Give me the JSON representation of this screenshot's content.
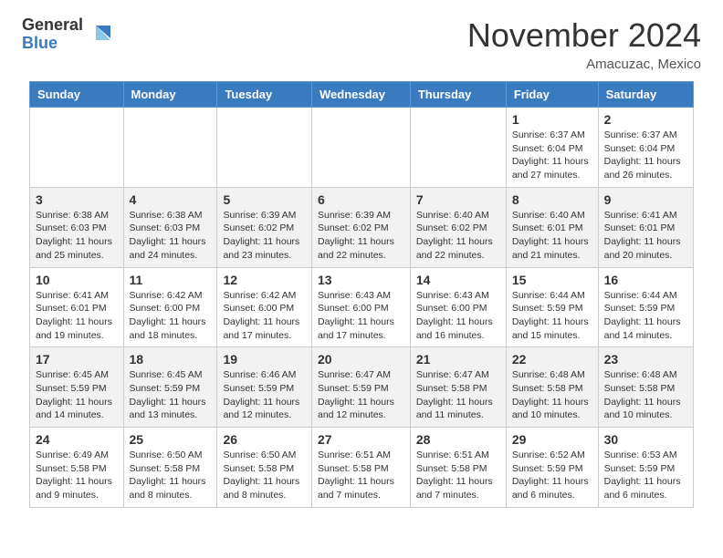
{
  "header": {
    "logo_general": "General",
    "logo_blue": "Blue",
    "month_title": "November 2024",
    "location": "Amacuzac, Mexico"
  },
  "days_of_week": [
    "Sunday",
    "Monday",
    "Tuesday",
    "Wednesday",
    "Thursday",
    "Friday",
    "Saturday"
  ],
  "weeks": [
    [
      {
        "day": "",
        "info": ""
      },
      {
        "day": "",
        "info": ""
      },
      {
        "day": "",
        "info": ""
      },
      {
        "day": "",
        "info": ""
      },
      {
        "day": "",
        "info": ""
      },
      {
        "day": "1",
        "info": "Sunrise: 6:37 AM\nSunset: 6:04 PM\nDaylight: 11 hours and 27 minutes."
      },
      {
        "day": "2",
        "info": "Sunrise: 6:37 AM\nSunset: 6:04 PM\nDaylight: 11 hours and 26 minutes."
      }
    ],
    [
      {
        "day": "3",
        "info": "Sunrise: 6:38 AM\nSunset: 6:03 PM\nDaylight: 11 hours and 25 minutes."
      },
      {
        "day": "4",
        "info": "Sunrise: 6:38 AM\nSunset: 6:03 PM\nDaylight: 11 hours and 24 minutes."
      },
      {
        "day": "5",
        "info": "Sunrise: 6:39 AM\nSunset: 6:02 PM\nDaylight: 11 hours and 23 minutes."
      },
      {
        "day": "6",
        "info": "Sunrise: 6:39 AM\nSunset: 6:02 PM\nDaylight: 11 hours and 22 minutes."
      },
      {
        "day": "7",
        "info": "Sunrise: 6:40 AM\nSunset: 6:02 PM\nDaylight: 11 hours and 22 minutes."
      },
      {
        "day": "8",
        "info": "Sunrise: 6:40 AM\nSunset: 6:01 PM\nDaylight: 11 hours and 21 minutes."
      },
      {
        "day": "9",
        "info": "Sunrise: 6:41 AM\nSunset: 6:01 PM\nDaylight: 11 hours and 20 minutes."
      }
    ],
    [
      {
        "day": "10",
        "info": "Sunrise: 6:41 AM\nSunset: 6:01 PM\nDaylight: 11 hours and 19 minutes."
      },
      {
        "day": "11",
        "info": "Sunrise: 6:42 AM\nSunset: 6:00 PM\nDaylight: 11 hours and 18 minutes."
      },
      {
        "day": "12",
        "info": "Sunrise: 6:42 AM\nSunset: 6:00 PM\nDaylight: 11 hours and 17 minutes."
      },
      {
        "day": "13",
        "info": "Sunrise: 6:43 AM\nSunset: 6:00 PM\nDaylight: 11 hours and 17 minutes."
      },
      {
        "day": "14",
        "info": "Sunrise: 6:43 AM\nSunset: 6:00 PM\nDaylight: 11 hours and 16 minutes."
      },
      {
        "day": "15",
        "info": "Sunrise: 6:44 AM\nSunset: 5:59 PM\nDaylight: 11 hours and 15 minutes."
      },
      {
        "day": "16",
        "info": "Sunrise: 6:44 AM\nSunset: 5:59 PM\nDaylight: 11 hours and 14 minutes."
      }
    ],
    [
      {
        "day": "17",
        "info": "Sunrise: 6:45 AM\nSunset: 5:59 PM\nDaylight: 11 hours and 14 minutes."
      },
      {
        "day": "18",
        "info": "Sunrise: 6:45 AM\nSunset: 5:59 PM\nDaylight: 11 hours and 13 minutes."
      },
      {
        "day": "19",
        "info": "Sunrise: 6:46 AM\nSunset: 5:59 PM\nDaylight: 11 hours and 12 minutes."
      },
      {
        "day": "20",
        "info": "Sunrise: 6:47 AM\nSunset: 5:59 PM\nDaylight: 11 hours and 12 minutes."
      },
      {
        "day": "21",
        "info": "Sunrise: 6:47 AM\nSunset: 5:58 PM\nDaylight: 11 hours and 11 minutes."
      },
      {
        "day": "22",
        "info": "Sunrise: 6:48 AM\nSunset: 5:58 PM\nDaylight: 11 hours and 10 minutes."
      },
      {
        "day": "23",
        "info": "Sunrise: 6:48 AM\nSunset: 5:58 PM\nDaylight: 11 hours and 10 minutes."
      }
    ],
    [
      {
        "day": "24",
        "info": "Sunrise: 6:49 AM\nSunset: 5:58 PM\nDaylight: 11 hours and 9 minutes."
      },
      {
        "day": "25",
        "info": "Sunrise: 6:50 AM\nSunset: 5:58 PM\nDaylight: 11 hours and 8 minutes."
      },
      {
        "day": "26",
        "info": "Sunrise: 6:50 AM\nSunset: 5:58 PM\nDaylight: 11 hours and 8 minutes."
      },
      {
        "day": "27",
        "info": "Sunrise: 6:51 AM\nSunset: 5:58 PM\nDaylight: 11 hours and 7 minutes."
      },
      {
        "day": "28",
        "info": "Sunrise: 6:51 AM\nSunset: 5:58 PM\nDaylight: 11 hours and 7 minutes."
      },
      {
        "day": "29",
        "info": "Sunrise: 6:52 AM\nSunset: 5:59 PM\nDaylight: 11 hours and 6 minutes."
      },
      {
        "day": "30",
        "info": "Sunrise: 6:53 AM\nSunset: 5:59 PM\nDaylight: 11 hours and 6 minutes."
      }
    ]
  ]
}
